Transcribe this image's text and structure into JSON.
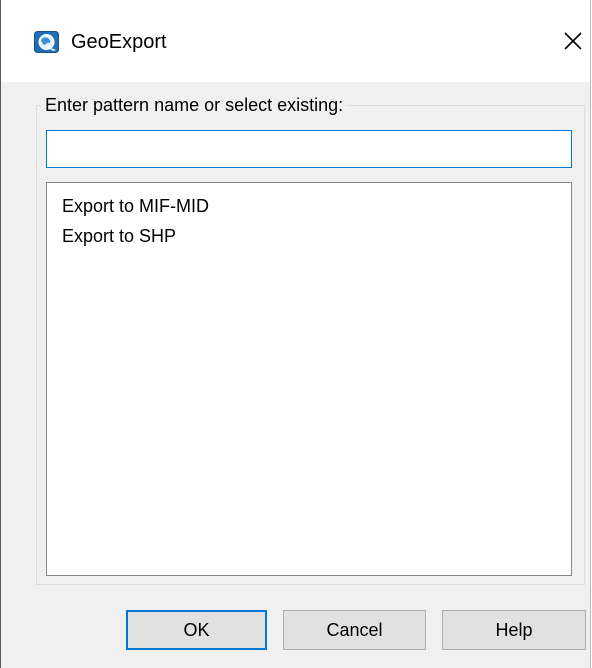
{
  "window": {
    "title": "GeoExport",
    "app_icon": "geoexport-globe-icon",
    "close_icon": "close-icon"
  },
  "pattern": {
    "group_label": "Enter pattern name or select existing:",
    "input_value": "",
    "items": [
      "Export to MIF-MID",
      "Export to SHP"
    ]
  },
  "buttons": {
    "ok_label": "OK",
    "cancel_label": "Cancel",
    "help_label": "Help"
  },
  "colors": {
    "focus_accent": "#0078d7",
    "dialog_background": "#f0f0f0",
    "button_face": "#e1e1e1"
  }
}
